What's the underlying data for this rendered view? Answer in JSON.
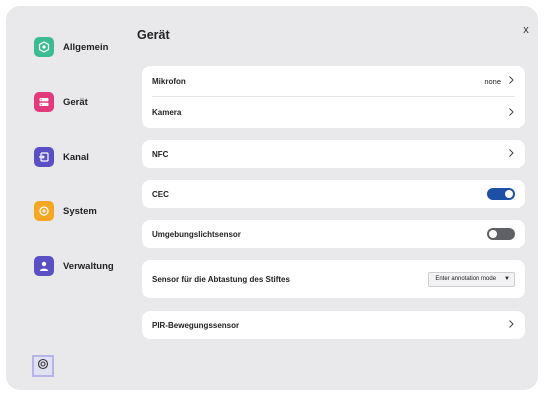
{
  "window": {
    "close_label": "x"
  },
  "sidebar": {
    "items": [
      {
        "label": "Allgemein",
        "icon": "general-icon",
        "color": "#3dbb93"
      },
      {
        "label": "Gerät",
        "icon": "device-icon",
        "color": "#e23a7c"
      },
      {
        "label": "Kanal",
        "icon": "input-source-icon",
        "color": "#5a4fc4"
      },
      {
        "label": "System",
        "icon": "system-icon",
        "color": "#f5a623"
      },
      {
        "label": "Verwaltung",
        "icon": "user-icon",
        "color": "#5a4fc4"
      }
    ],
    "settings_icon": "gear-icon"
  },
  "main": {
    "title": "Gerät",
    "mikrofon": {
      "label": "Mikrofon",
      "value": "none"
    },
    "kamera": {
      "label": "Kamera"
    },
    "nfc": {
      "label": "NFC"
    },
    "cec": {
      "label": "CEC",
      "enabled": true
    },
    "umgebung": {
      "label": "Umgebungslichtsensor",
      "enabled": false
    },
    "stift": {
      "label": "Sensor für die Abtastung des Stiftes",
      "selected": "Enter annotation mode"
    },
    "pir": {
      "label": "PIR-Bewegungssensor"
    }
  },
  "colors": {
    "accent": "#1d4fa5",
    "toggle_off": "#5f5f66",
    "panel": "#e9e9ec"
  }
}
